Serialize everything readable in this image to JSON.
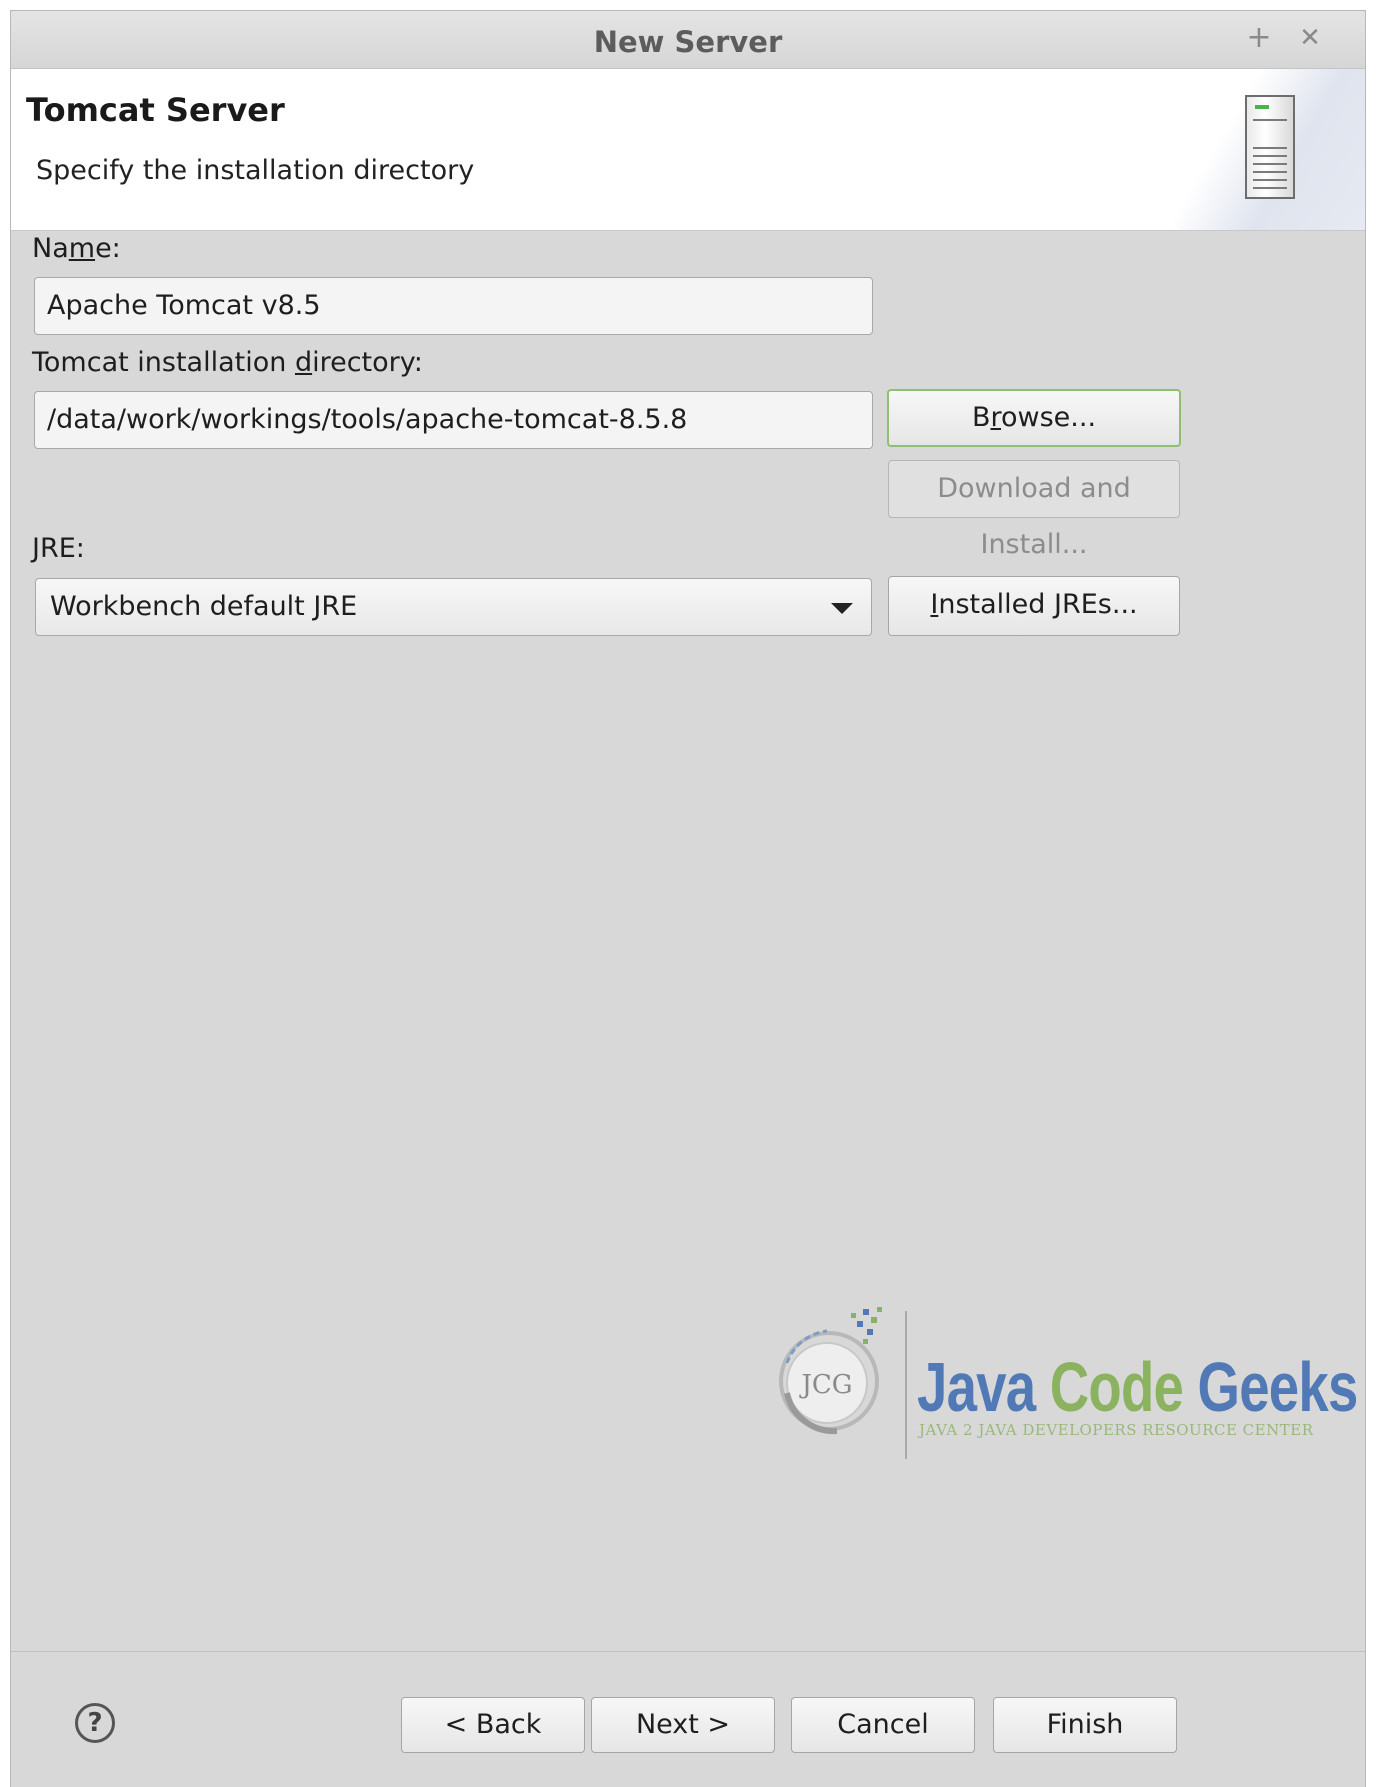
{
  "window": {
    "title": "New Server",
    "maximize_glyph": "+",
    "close_glyph": "✕"
  },
  "banner": {
    "heading": "Tomcat Server",
    "description": "Specify the installation directory",
    "icon": "server-icon"
  },
  "form": {
    "name_label_pre": "Na",
    "name_label_mnemonic": "m",
    "name_label_post": "e:",
    "name_value": "Apache Tomcat v8.5",
    "dir_label_pre": "Tomcat installation ",
    "dir_label_mnemonic": "d",
    "dir_label_post": "irectory:",
    "dir_value": "/data/work/workings/tools/apache-tomcat-8.5.8",
    "browse_pre": "B",
    "browse_mnemonic": "r",
    "browse_post": "owse...",
    "download_label": "Download and Install...",
    "jre_label": "JRE:",
    "jre_selected": "Workbench default JRE",
    "installed_jres_mnemonic": "I",
    "installed_jres_post": "nstalled JREs..."
  },
  "watermark": {
    "logo_monogram": "JCG",
    "word1": "Java",
    "word2": "Code",
    "word3": "Geeks",
    "tagline": "JAVA 2 JAVA DEVELOPERS RESOURCE CENTER",
    "colors": {
      "blue": "#5079b5",
      "green": "#8ab25f"
    }
  },
  "footer": {
    "help_glyph": "?",
    "back_label": "< Back",
    "next_label": "Next >",
    "cancel_label": "Cancel",
    "finish_label": "Finish"
  },
  "colors": {
    "dialog_bg": "#d8d8d8",
    "focus_border": "#8fbf72"
  }
}
